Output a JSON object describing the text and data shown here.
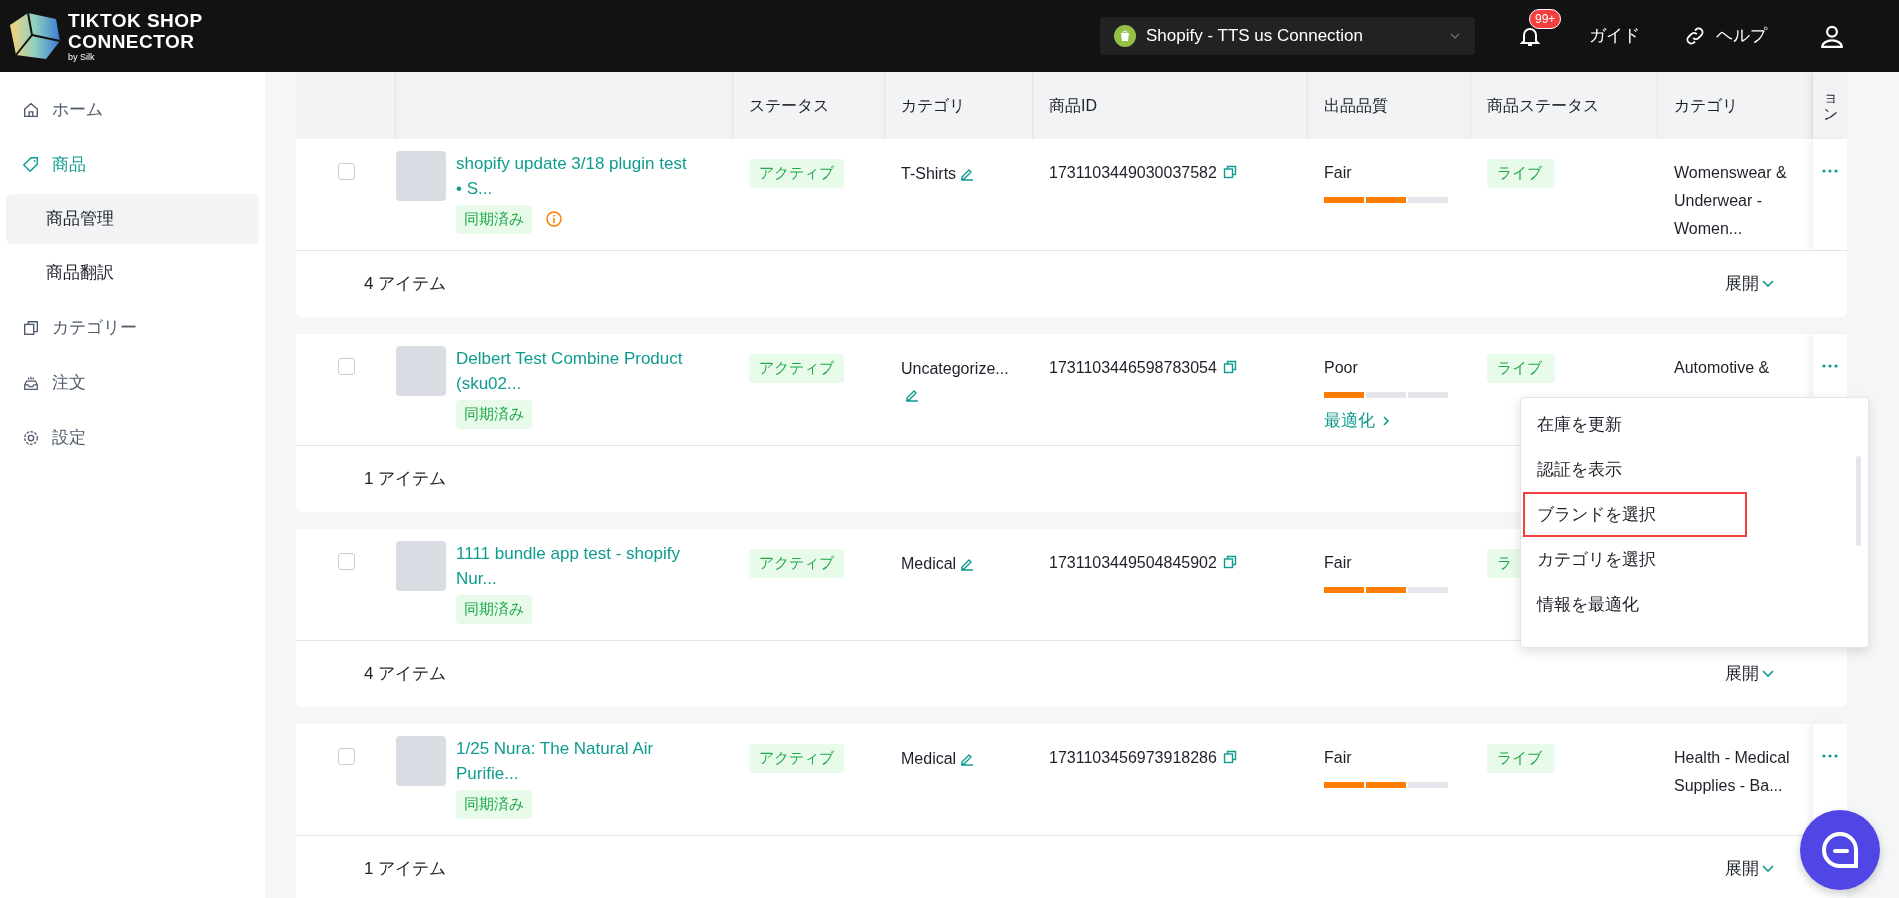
{
  "header": {
    "logo": {
      "line_1": "TIKTOK SHOP",
      "line_2": "CONNECTOR",
      "byline": "by Silk"
    },
    "store_selector": {
      "value": "Shopify - TTS us Connection"
    },
    "notifications": {
      "badge": "99+"
    },
    "links": [
      {
        "kind": "guide",
        "label": "ガイド"
      },
      {
        "kind": "help",
        "label": "ヘルプ"
      }
    ]
  },
  "sidebar": {
    "items": [
      {
        "label": "ホーム",
        "selected": false
      },
      {
        "label": "商品",
        "selected": true,
        "children": [
          {
            "label": "商品管理",
            "selected": true
          },
          {
            "label": "商品翻訳",
            "selected": false
          }
        ]
      },
      {
        "label": "カテゴリー",
        "selected": false
      },
      {
        "label": "注文",
        "selected": false
      },
      {
        "label": "設定",
        "selected": false
      }
    ]
  },
  "table": {
    "columns": [
      "ステータス",
      "カテゴリ",
      "商品ID",
      "出品品質",
      "商品ステータス",
      "カテゴリ",
      "ョン"
    ],
    "groups": [
      {
        "product": {
          "checked": false,
          "title": "shopify update 3/18 plugin test • S...",
          "sync": "同期済み",
          "warning": true
        },
        "status": "アクティブ",
        "category": "T-Shirts",
        "product_id": "1731103449030037582",
        "quality": {
          "label": "Fair",
          "level": 0.66
        },
        "listing_status": "ライブ",
        "category_2": "Womenswear & Underwear - Women...",
        "footer": {
          "count": "4 アイテム",
          "expand": "展開"
        }
      },
      {
        "product": {
          "checked": false,
          "title": "Delbert Test Combine Product (sku02...",
          "sync": "同期済み"
        },
        "status": "アクティブ",
        "category": "Uncategorize...",
        "product_id": "1731103446598783054",
        "quality": {
          "label": "Poor",
          "level": 0.33,
          "link": "最適化"
        },
        "listing_status": "ライブ",
        "category_2": "Automotive &",
        "footer": {
          "count": "1 アイテム"
        }
      },
      {
        "product": {
          "checked": false,
          "title": "1111 bundle app test - shopify Nur...",
          "sync": "同期済み"
        },
        "status": "アクティブ",
        "category": "Medical",
        "product_id": "1731103449504845902",
        "quality": {
          "label": "Fair",
          "level": 0.66
        },
        "listing_status": "ラ",
        "footer": {
          "count": "4 アイテム",
          "expand": "展開"
        }
      },
      {
        "product": {
          "checked": false,
          "title": "1/25 Nura: The Natural Air Purifie...",
          "sync": "同期済み"
        },
        "status": "アクティブ",
        "category": "Medical",
        "product_id": "1731103456973918286",
        "quality": {
          "label": "Fair",
          "level": 0.66
        },
        "listing_status": "ライブ",
        "category_2": "Health - Medical Supplies - Ba...",
        "footer": {
          "count": "1 アイテム",
          "expand": "展開"
        }
      }
    ]
  },
  "row_menu": {
    "items": [
      {
        "label": "在庫を更新",
        "highlighted": false
      },
      {
        "label": "認証を表示",
        "highlighted": false
      },
      {
        "label": "ブランドを選択",
        "highlighted": true
      },
      {
        "label": "カテゴリを選択",
        "highlighted": false
      },
      {
        "label": "情報を最適化",
        "highlighted": false
      }
    ]
  }
}
